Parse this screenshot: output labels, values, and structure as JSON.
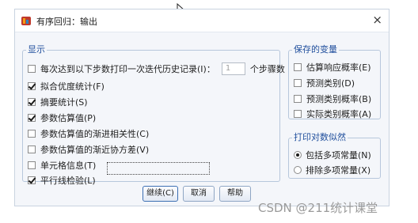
{
  "dialog": {
    "title": "有序回归：输出",
    "close_icon": "×"
  },
  "display_group": {
    "title": "显示",
    "iteration_option": {
      "label": "每次达到以下步数打印一次迭代历史记录(I)：",
      "value": "1",
      "suffix": "个步骤数",
      "checked": false,
      "disabled": true
    },
    "options": [
      {
        "label": "拟合优度统计(F)",
        "checked": true
      },
      {
        "label": "摘要统计(S)",
        "checked": true
      },
      {
        "label": "参数估算值(P)",
        "checked": true
      },
      {
        "label": "参数估算值的渐进相关性(C)",
        "checked": false
      },
      {
        "label": "参数估算值的渐近协方差(V)",
        "checked": false
      },
      {
        "label": "单元格信息(T)",
        "checked": false
      },
      {
        "label": "平行线检验(L)",
        "checked": true
      }
    ]
  },
  "saved_vars_group": {
    "title": "保存的变量",
    "options": [
      {
        "label": "估算响应概率(E)",
        "checked": false
      },
      {
        "label": "预测类别(D)",
        "checked": false
      },
      {
        "label": "预测类别概率(B)",
        "checked": false
      },
      {
        "label": "实际类别概率(A)",
        "checked": false
      }
    ]
  },
  "loglik_group": {
    "title": "打印对数似然",
    "options": [
      {
        "label": "包括多项常量(N)",
        "selected": true
      },
      {
        "label": "排除多项常量(X)",
        "selected": false
      }
    ]
  },
  "buttons": {
    "continue": "继续(C)",
    "cancel": "取消",
    "help": "帮助"
  },
  "watermark": "CSDN @211统计课堂",
  "colors": {
    "group_title": "#1f4e9c",
    "group_border": "#b7c7dc",
    "dialog_bg": "#f4f6fa"
  },
  "icons": {
    "app": "spss-app-icon",
    "cursor": "mouse-cursor-icon",
    "close": "close-icon"
  }
}
